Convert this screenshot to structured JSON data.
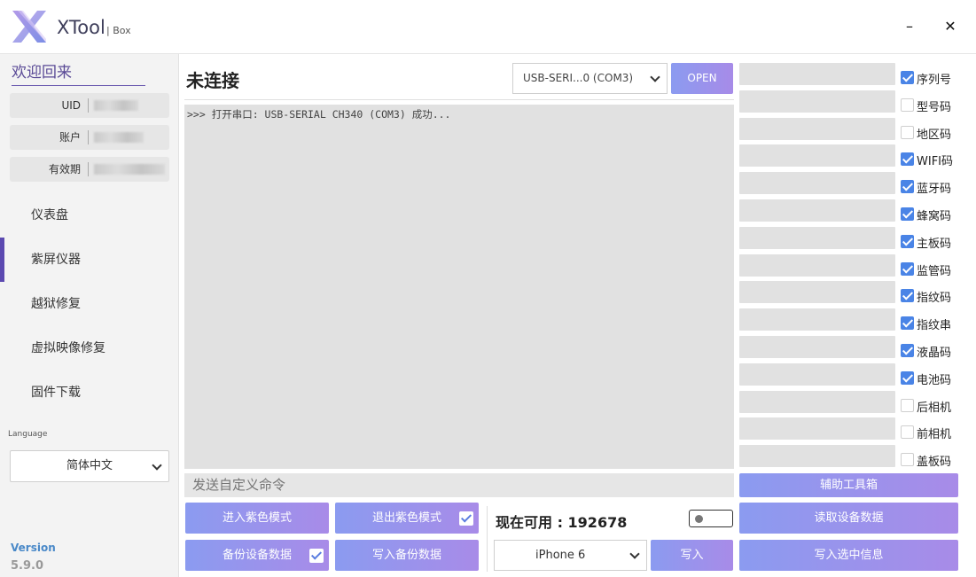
{
  "app": {
    "title": "XTool",
    "subtitle": "| Box",
    "minimize": "–",
    "close": "✕"
  },
  "sidebar": {
    "welcome": "欢迎回来",
    "info": [
      {
        "label": "UID",
        "value": ""
      },
      {
        "label": "账户",
        "value": ""
      },
      {
        "label": "有效期",
        "value": ""
      }
    ],
    "nav": [
      {
        "label": "仪表盘",
        "active": false
      },
      {
        "label": "紫屏仪器",
        "active": true
      },
      {
        "label": "越狱修复",
        "active": false
      },
      {
        "label": "虚拟映像修复",
        "active": false
      },
      {
        "label": "固件下载",
        "active": false
      }
    ],
    "language_label": "Language",
    "language_value": "简体中文",
    "version_label": "Version",
    "version_value": "5.9.0"
  },
  "main": {
    "status": "未连接",
    "port_value": "USB-SERI...0 (COM3)",
    "open_label": "OPEN",
    "console_text": ">>> 打开串口: USB-SERIAL CH340 (COM3) 成功...",
    "command_placeholder": "发送自定义命令"
  },
  "actions": {
    "enter_purple": "进入紫色模式",
    "exit_purple": "退出紫色模式",
    "backup": "备份设备数据",
    "write_backup": "写入备份数据",
    "available": "现在可用 : 192678",
    "model_value": "iPhone 6",
    "write": "写入",
    "toolbox": "辅助工具箱",
    "read_device": "读取设备数据",
    "write_selected": "写入选中信息"
  },
  "fields": [
    {
      "label": "序列号",
      "checked": true
    },
    {
      "label": "型号码",
      "checked": false
    },
    {
      "label": "地区码",
      "checked": false
    },
    {
      "label": "WIFI码",
      "checked": true
    },
    {
      "label": "蓝牙码",
      "checked": true
    },
    {
      "label": "蜂窝码",
      "checked": true
    },
    {
      "label": "主板码",
      "checked": true
    },
    {
      "label": "监管码",
      "checked": true
    },
    {
      "label": "指纹码",
      "checked": true
    },
    {
      "label": "指纹串",
      "checked": true
    },
    {
      "label": "液晶码",
      "checked": true
    },
    {
      "label": "电池码",
      "checked": true
    },
    {
      "label": "后相机",
      "checked": false
    },
    {
      "label": "前相机",
      "checked": false
    },
    {
      "label": "盖板码",
      "checked": false
    }
  ],
  "colors": {
    "accent": "#8b9bf0",
    "accent2": "#a88be8",
    "nav_active": "#5b49b0",
    "checkbox": "#4a84e6"
  }
}
